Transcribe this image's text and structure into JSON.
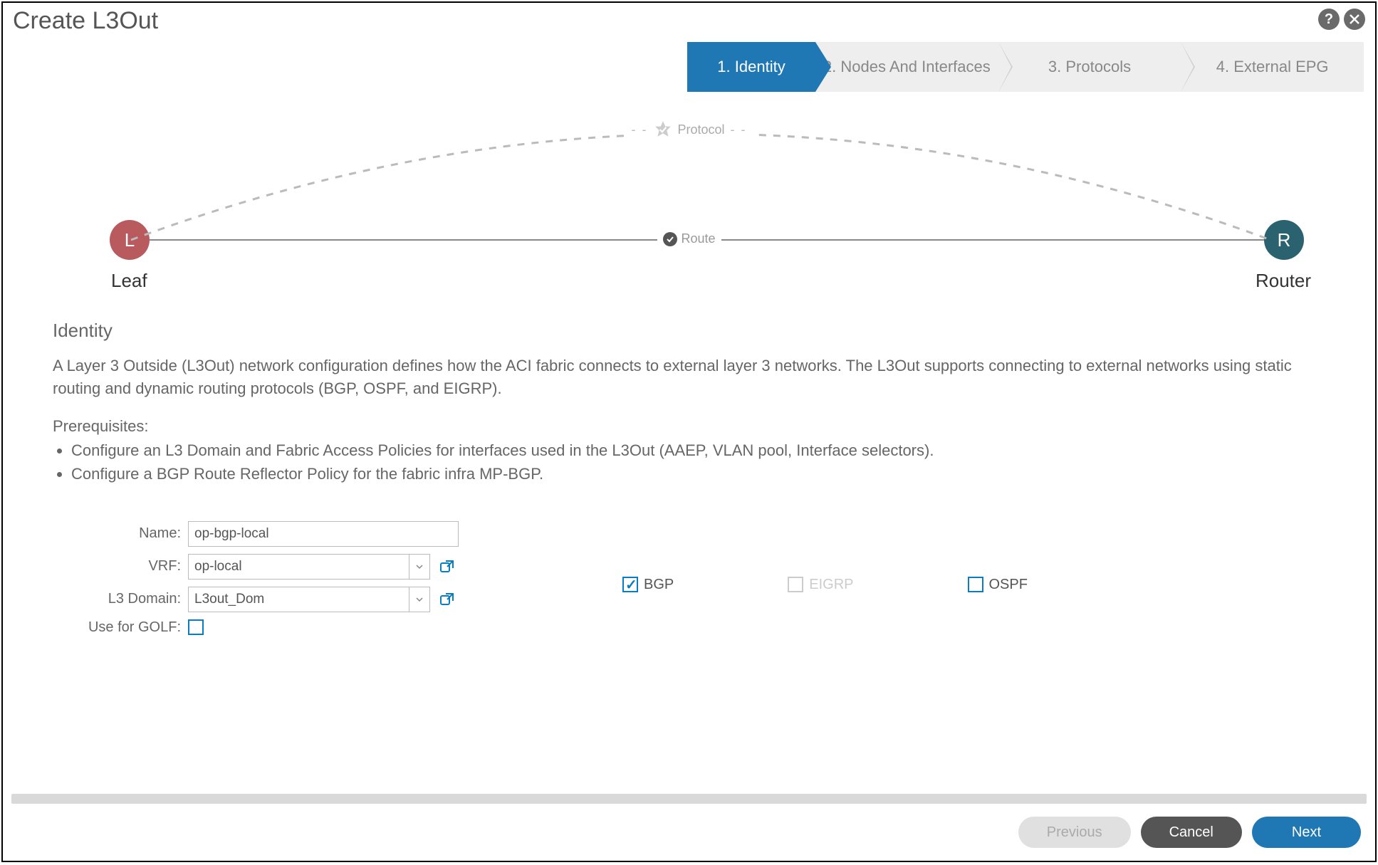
{
  "title": "Create L3Out",
  "wizard": {
    "steps": [
      {
        "label": "1. Identity",
        "active": true
      },
      {
        "label": "2. Nodes And Interfaces",
        "active": false
      },
      {
        "label": "3. Protocols",
        "active": false
      },
      {
        "label": "4. External EPG",
        "active": false
      }
    ]
  },
  "topology": {
    "leaf_letter": "L",
    "leaf_label": "Leaf",
    "router_letter": "R",
    "router_label": "Router",
    "route_label": "Route",
    "protocol_label": "Protocol"
  },
  "identity": {
    "heading": "Identity",
    "description": "A Layer 3 Outside (L3Out) network configuration defines how the ACI fabric connects to external layer 3 networks. The L3Out supports connecting to external networks using static routing and dynamic routing protocols (BGP, OSPF, and EIGRP).",
    "prereq_heading": "Prerequisites:",
    "prereqs": [
      "Configure an L3 Domain and Fabric Access Policies for interfaces used in the L3Out (AAEP, VLAN pool, Interface selectors).",
      "Configure a BGP Route Reflector Policy for the fabric infra MP-BGP."
    ]
  },
  "form": {
    "labels": {
      "name": "Name:",
      "vrf": "VRF:",
      "l3domain": "L3 Domain:",
      "golf": "Use for GOLF:"
    },
    "values": {
      "name": "op-bgp-local",
      "vrf": "op-local",
      "l3domain": "L3out_Dom",
      "golf_checked": false
    },
    "protocols": {
      "bgp": {
        "label": "BGP",
        "checked": true,
        "enabled": true
      },
      "eigrp": {
        "label": "EIGRP",
        "checked": false,
        "enabled": false
      },
      "ospf": {
        "label": "OSPF",
        "checked": false,
        "enabled": true
      }
    }
  },
  "footer": {
    "previous": "Previous",
    "cancel": "Cancel",
    "next": "Next"
  }
}
